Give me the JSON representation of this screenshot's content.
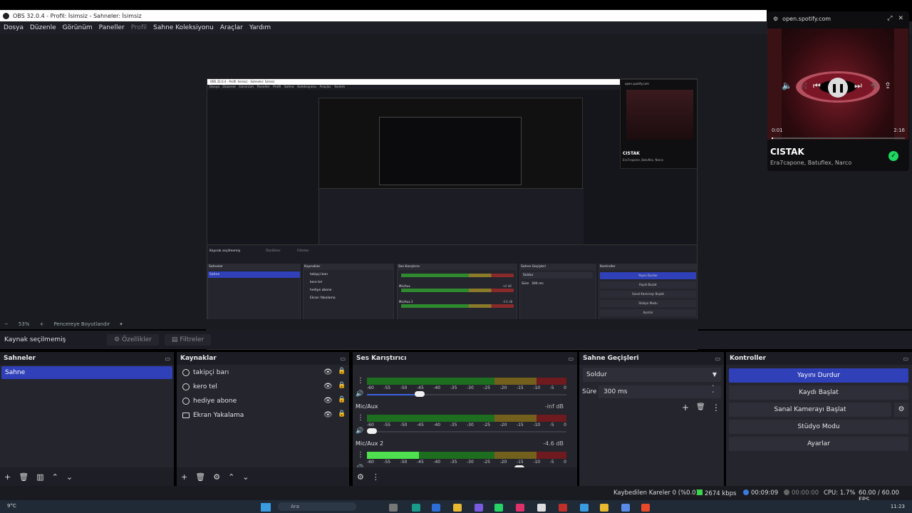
{
  "window": {
    "title": "OBS 32.0.4 - Profil: İsimsiz - Sahneler: İsimsiz"
  },
  "menu": [
    "Dosya",
    "Düzenle",
    "Görünüm",
    "Paneller",
    "Profil",
    "Sahne Koleksiyonu",
    "Araçlar",
    "Yardım"
  ],
  "spotify": {
    "url": "open.spotify.com",
    "track": "CISTAK",
    "artists": "Era7capone, Batuflex, Narco",
    "time_current": "0:01",
    "time_total": "2:16",
    "progress": 0.01,
    "accent": "#1ed760"
  },
  "zoom": {
    "minus": "−",
    "value": "53%",
    "plus": "+",
    "fit": "Pencereye Boyutlandır"
  },
  "source_bar": {
    "label": "Kaynak seçilmemiş",
    "properties": "Özellikler",
    "filters": "Filtreler"
  },
  "scenes": {
    "title": "Sahneler",
    "items": [
      "Sahne"
    ]
  },
  "sources": {
    "title": "Kaynaklar",
    "items": [
      {
        "name": "takipçi barı",
        "type": "browser"
      },
      {
        "name": "kero tel",
        "type": "browser"
      },
      {
        "name": "hediye abone",
        "type": "browser"
      },
      {
        "name": "Ekran Yakalama",
        "type": "display"
      }
    ]
  },
  "mixer": {
    "title": "Ses Karıştırıcı",
    "ticks": [
      "-60",
      "-55",
      "-50",
      "-45",
      "-40",
      "-35",
      "-30",
      "-25",
      "-20",
      "-15",
      "-10",
      "-5",
      "0"
    ],
    "channels": [
      {
        "name": "",
        "db": "",
        "level": 0.0,
        "volume": 0.25
      },
      {
        "name": "Mic/Aux",
        "db": "-inf dB",
        "level": 0.0,
        "volume": 0.0
      },
      {
        "name": "Mic/Aux 2",
        "db": "-4.6 dB",
        "level": 0.26,
        "volume": 0.78
      }
    ]
  },
  "transitions": {
    "title": "Sahne Geçişleri",
    "selected": "Soldur",
    "duration_label": "Süre",
    "duration": "300 ms"
  },
  "controls": {
    "title": "Kontroller",
    "buttons": [
      "Yayını Durdur",
      "Kaydı Başlat",
      "Sanal Kamerayı Başlat",
      "Stüdyo Modu",
      "Ayarlar"
    ]
  },
  "status": {
    "dropped": "Kaybedilen Kareler 0 (%0.0)",
    "bitrate": "2674 kbps",
    "stream_time": "00:09:09",
    "rec_time": "00:00:00",
    "cpu": "CPU: 1.7%",
    "fps": "60.00 / 60.00 FPS"
  },
  "taskbar": {
    "weather": "9°C",
    "search": "Ara",
    "time": "11:23"
  },
  "nested": {
    "title": "OBS 32.0.4 - Profil: İsimsiz - Sahneler: İsimsiz",
    "menu": "Dosya Düzenle Görünüm Paneller Profil Sahne Koleksiyonu Araçlar Yardım",
    "spot_url": "open.spotify.com",
    "no_source": "Kaynak seçilmemiş",
    "props": "Özellikler",
    "filters": "Filtreler",
    "scenes": "Sahneler",
    "scene": "Sahne",
    "sources": "Kaynaklar",
    "src": [
      "takipçi barı",
      "kero tel",
      "hediye abone",
      "Ekran Yakalama"
    ],
    "mixer": "Ses Karıştırıcı",
    "mic": "Mic/Aux",
    "mic_db": "-inf dB",
    "mic2": "Mic/Aux 2",
    "mic2_db": "-4.6 dB",
    "trans": "Sahne Geçişleri",
    "soldur": "Soldur",
    "sure": "Süre",
    "dur": "300 ms",
    "controls": "Kontroller",
    "btns": [
      "Yayını Durdur",
      "Kaydı Başlat",
      "Sanal Kamerayı Başlat",
      "Stüdyo Modu",
      "Ayarlar"
    ],
    "status": "Kaybedilen Kareler 0 (%0.0)   2674 kbps   00:09:09   00:00:00   CPU: 1.7%   60.00 / 60.00 FPS"
  }
}
